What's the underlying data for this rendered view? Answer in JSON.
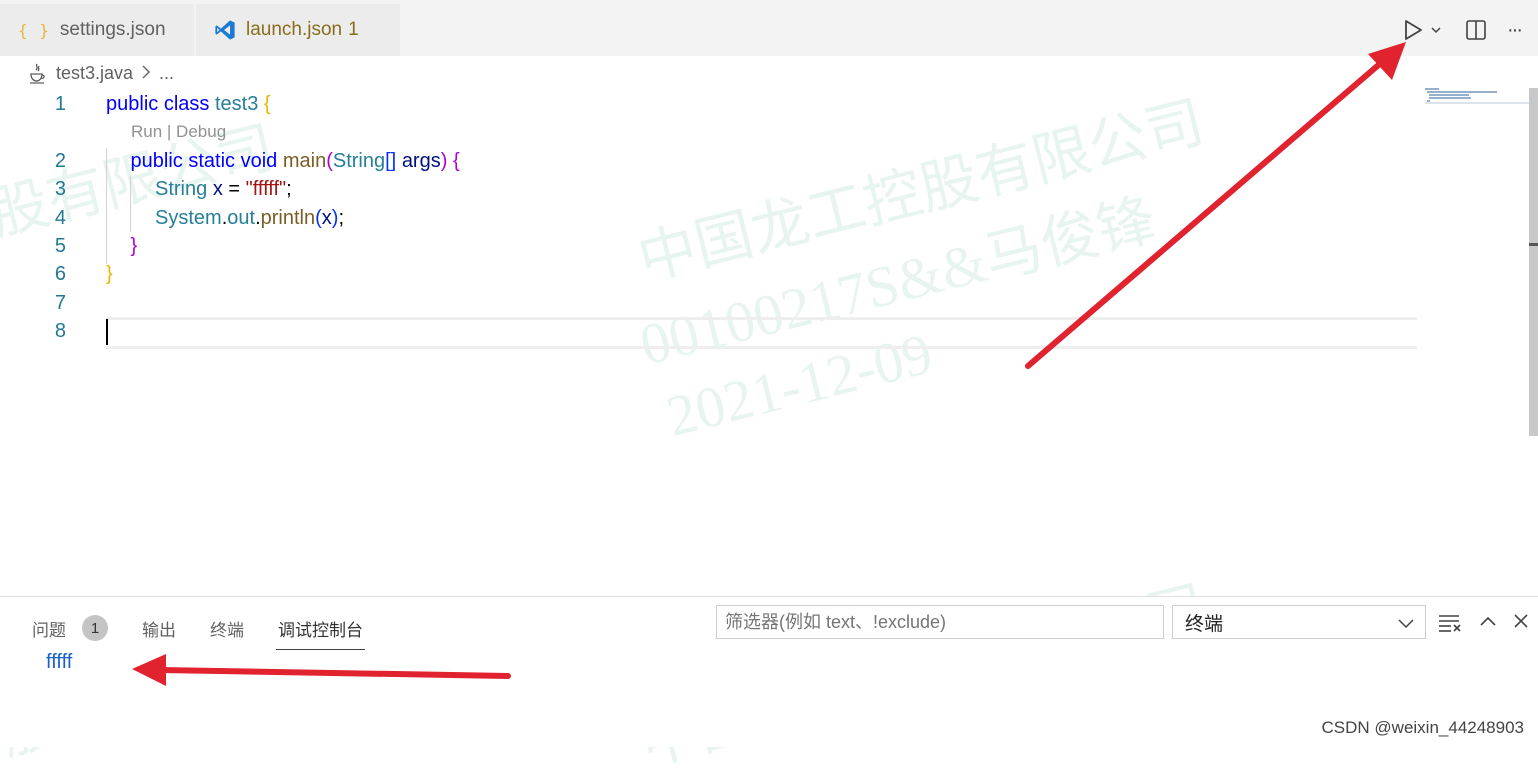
{
  "tabs": [
    {
      "icon": "json-braces-icon",
      "glyph": "{ }",
      "label": "settings.json"
    },
    {
      "icon": "vscode-icon",
      "label": "launch.json",
      "badge": "1"
    }
  ],
  "toolbar": {
    "run_icon": "play-icon",
    "dropdown_icon": "chevron-down-icon",
    "split_icon": "split-editor-icon",
    "more_icon": "ellipsis-icon",
    "more_glyph": "···"
  },
  "breadcrumb": {
    "file": "test3.java",
    "rest": "..."
  },
  "editor": {
    "lines": [
      {
        "num": "1",
        "tokens": [
          {
            "t": "public",
            "c": "kw"
          },
          {
            "t": " ",
            "c": "plain"
          },
          {
            "t": "class",
            "c": "kw"
          },
          {
            "t": " ",
            "c": "plain"
          },
          {
            "t": "test3",
            "c": "ty"
          },
          {
            "t": " ",
            "c": "plain"
          },
          {
            "t": "{",
            "c": "b1"
          }
        ]
      },
      {
        "num": "2",
        "tokens": [
          {
            "t": "public",
            "c": "kw"
          },
          {
            "t": " ",
            "c": "plain"
          },
          {
            "t": "static",
            "c": "kw"
          },
          {
            "t": " ",
            "c": "plain"
          },
          {
            "t": "void",
            "c": "kw"
          },
          {
            "t": " ",
            "c": "plain"
          },
          {
            "t": "main",
            "c": "fn"
          },
          {
            "t": "(",
            "c": "b2"
          },
          {
            "t": "String",
            "c": "ty"
          },
          {
            "t": "[]",
            "c": "b3"
          },
          {
            "t": " ",
            "c": "plain"
          },
          {
            "t": "args",
            "c": "var"
          },
          {
            "t": ")",
            "c": "b2"
          },
          {
            "t": " ",
            "c": "plain"
          },
          {
            "t": "{",
            "c": "b2"
          }
        ]
      },
      {
        "num": "3",
        "tokens": [
          {
            "t": "String",
            "c": "ty"
          },
          {
            "t": " ",
            "c": "plain"
          },
          {
            "t": "x",
            "c": "var"
          },
          {
            "t": " = ",
            "c": "plain"
          },
          {
            "t": "\"fffff\"",
            "c": "str"
          },
          {
            "t": ";",
            "c": "plain"
          }
        ]
      },
      {
        "num": "4",
        "tokens": [
          {
            "t": "System",
            "c": "ty"
          },
          {
            "t": ".",
            "c": "plain"
          },
          {
            "t": "out",
            "c": "ty"
          },
          {
            "t": ".",
            "c": "plain"
          },
          {
            "t": "println",
            "c": "fn"
          },
          {
            "t": "(",
            "c": "b3"
          },
          {
            "t": "x",
            "c": "var"
          },
          {
            "t": ")",
            "c": "b3"
          },
          {
            "t": ";",
            "c": "plain"
          }
        ]
      },
      {
        "num": "5",
        "tokens": [
          {
            "t": "}",
            "c": "b2"
          }
        ]
      },
      {
        "num": "6",
        "tokens": [
          {
            "t": "}",
            "c": "b1"
          }
        ]
      },
      {
        "num": "7",
        "tokens": []
      },
      {
        "num": "8",
        "tokens": []
      }
    ],
    "codelens": "Run | Debug"
  },
  "panel": {
    "tabs": {
      "problems": "问题",
      "problems_count": "1",
      "output": "输出",
      "terminal": "终端",
      "debug_console": "调试控制台"
    },
    "filter_placeholder": "筛选器(例如 text、!exclude)",
    "select_value": "终端",
    "output_text": "fffff"
  },
  "watermark": {
    "company": "中国龙工控股有限公司",
    "company_partial": "股有限公司",
    "id": "00100217S&&马俊锋",
    "date": "2021-12-09"
  },
  "footer": "CSDN @weixin_44248903",
  "colors": {
    "arrow": "#e0232f",
    "keyword": "#0000ff",
    "type": "#267f99",
    "function": "#795e26",
    "string": "#a31515"
  }
}
